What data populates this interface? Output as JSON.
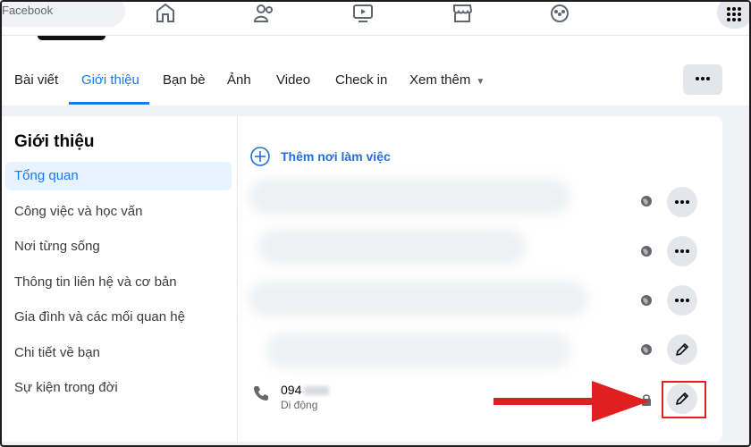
{
  "topbar": {
    "search_text": "Facebook"
  },
  "tabs": [
    {
      "label": "Bài viết"
    },
    {
      "label": "Giới thiệu",
      "active": true
    },
    {
      "label": "Bạn bè"
    },
    {
      "label": "Ảnh"
    },
    {
      "label": "Video"
    },
    {
      "label": "Check in"
    },
    {
      "label": "Xem thêm"
    }
  ],
  "about": {
    "title": "Giới thiệu",
    "sidebar": [
      {
        "label": "Tổng quan",
        "active": true
      },
      {
        "label": "Công việc và học vấn"
      },
      {
        "label": "Nơi từng sống"
      },
      {
        "label": "Thông tin liên hệ và cơ bản"
      },
      {
        "label": "Gia đình và các mối quan hệ"
      },
      {
        "label": "Chi tiết về bạn"
      },
      {
        "label": "Sự kiện trong đời"
      }
    ],
    "add_work_label": "Thêm nơi làm việc",
    "phone": {
      "number": "094",
      "type": "Di động"
    }
  },
  "colors": {
    "accent": "#1877f2",
    "highlight": "#e02020"
  },
  "icons": {
    "audience_public": "globe-icon",
    "audience_private": "lock-icon",
    "edit": "pencil-icon",
    "more": "more-dots-icon"
  }
}
